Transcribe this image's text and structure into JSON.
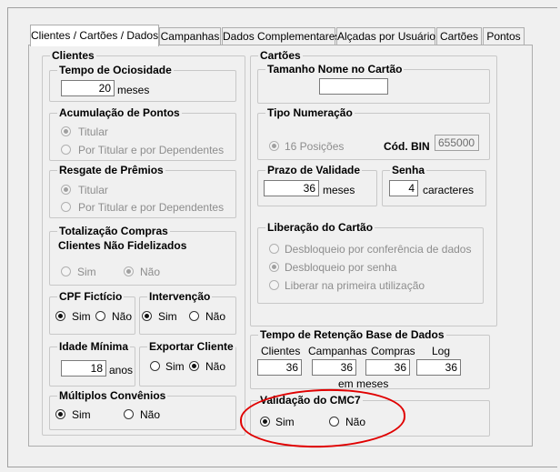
{
  "tabs": [
    "Clientes / Cartões / Dados",
    "Campanhas",
    "Dados Complementares",
    "Alçadas por Usuário",
    "Cartões",
    "Pontos"
  ],
  "clientes": {
    "title": "Clientes",
    "ociosidade": {
      "title": "Tempo de Ociosidade",
      "value": "20",
      "unit": "meses"
    },
    "acumulacao": {
      "title": "Acumulação de Pontos",
      "opt1": "Titular",
      "opt2": "Por Titular e por Dependentes"
    },
    "resgate": {
      "title": "Resgate de Prêmios",
      "opt1": "Titular",
      "opt2": "Por Titular e por Dependentes"
    },
    "totalizacao": {
      "title1": "Totalização Compras",
      "title2": "Clientes Não Fidelizados",
      "sim": "Sim",
      "nao": "Não"
    },
    "cpf": {
      "title": "CPF Fictício",
      "sim": "Sim",
      "nao": "Não"
    },
    "intervencao": {
      "title": "Intervenção",
      "sim": "Sim",
      "nao": "Não"
    },
    "idade": {
      "title": "Idade Mínima",
      "value": "18",
      "unit": "anos"
    },
    "exportar": {
      "title": "Exportar Cliente",
      "sim": "Sim",
      "nao": "Não"
    },
    "multiplos": {
      "title": "Múltiplos Convênios",
      "sim": "Sim",
      "nao": "Não"
    }
  },
  "cartoes": {
    "title": "Cartões",
    "tamanho": {
      "title": "Tamanho Nome no Cartão",
      "value": ""
    },
    "numeracao": {
      "title": "Tipo Numeração",
      "opt": "16 Posições",
      "bin_label": "Cód. BIN",
      "bin_value": "655000"
    },
    "validade": {
      "title": "Prazo de Validade",
      "value": "36",
      "unit": "meses"
    },
    "senha": {
      "title": "Senha",
      "value": "4",
      "unit": "caracteres"
    },
    "liberacao": {
      "title": "Liberação do Cartão",
      "opt1": "Desbloqueio por conferência de dados",
      "opt2": "Desbloqueio por senha",
      "opt3": "Liberar na primeira utilização"
    }
  },
  "retencao": {
    "title": "Tempo de Retenção Base de Dados",
    "cols": [
      {
        "label": "Clientes",
        "value": "36"
      },
      {
        "label": "Campanhas",
        "value": "36"
      },
      {
        "label": "Compras",
        "value": "36"
      },
      {
        "label": "Log",
        "value": "36"
      }
    ],
    "unit": "em meses"
  },
  "cmc7": {
    "title": "Validação do CMC7",
    "sim": "Sim",
    "nao": "Não"
  },
  "colors": {
    "highlight": "#e00000"
  }
}
